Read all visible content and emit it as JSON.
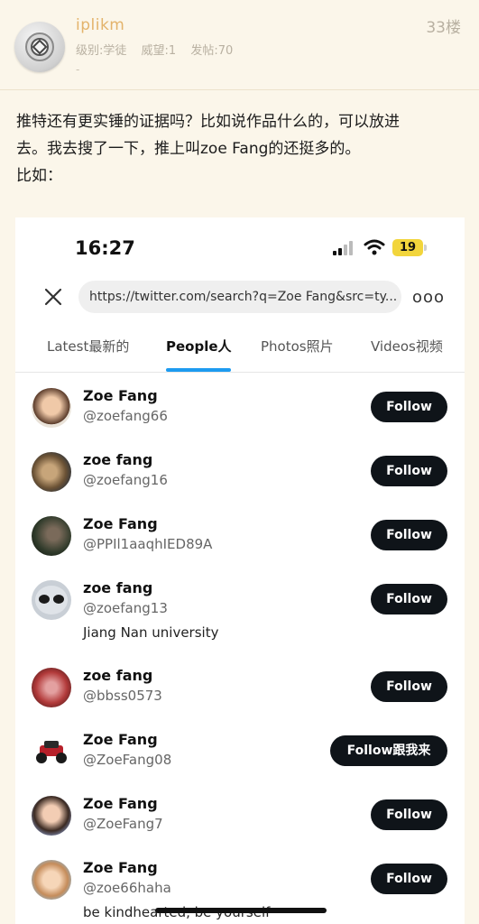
{
  "post": {
    "username": "iplikm",
    "level": "级别:学徒",
    "prestige": "威望:1",
    "posts": "发帖:70",
    "dash": "-",
    "floor": "33楼",
    "body_line1": "推特还有更实锤的证据吗？比如说作品什么的，可以放进",
    "body_line2": "去。我去搜了一下，推上叫zoe Fang的还挺多的。",
    "body_line3": "比如："
  },
  "phone": {
    "time": "16:27",
    "battery": "19",
    "url": "https://twitter.com/search?q=Zoe Fang&src=ty...",
    "more": "ooo",
    "tabs": [
      "Latest最新的",
      "People人",
      "Photos照片",
      "Videos视频"
    ]
  },
  "users": [
    {
      "name": "Zoe Fang",
      "handle": "@zoefang66",
      "bio": "",
      "follow": "Follow",
      "avatar": "woman-portrait"
    },
    {
      "name": "zoe fang",
      "handle": "@zoefang16",
      "bio": "",
      "follow": "Follow",
      "avatar": "dog-photo"
    },
    {
      "name": "Zoe Fang",
      "handle": "@PPIl1aaqhIED89A",
      "bio": "",
      "follow": "Follow",
      "avatar": "dark-photo"
    },
    {
      "name": "zoe fang",
      "handle": "@zoefang13",
      "bio": "Jiang Nan university",
      "follow": "Follow",
      "avatar": "alien-photo"
    },
    {
      "name": "zoe fang",
      "handle": "@bbss0573",
      "bio": "",
      "follow": "Follow",
      "avatar": "red-object-photo"
    },
    {
      "name": "Zoe Fang",
      "handle": "@ZoeFang08",
      "bio": "",
      "follow": "Follow跟我来",
      "avatar": "toy-car-photo"
    },
    {
      "name": "Zoe Fang",
      "handle": "@ZoeFang7",
      "bio": "",
      "follow": "Follow",
      "avatar": "child-portrait"
    },
    {
      "name": "Zoe Fang",
      "handle": "@zoe66haha",
      "bio": "be kindhearted, be yourself",
      "follow": "Follow",
      "avatar": "baby-portrait"
    }
  ]
}
